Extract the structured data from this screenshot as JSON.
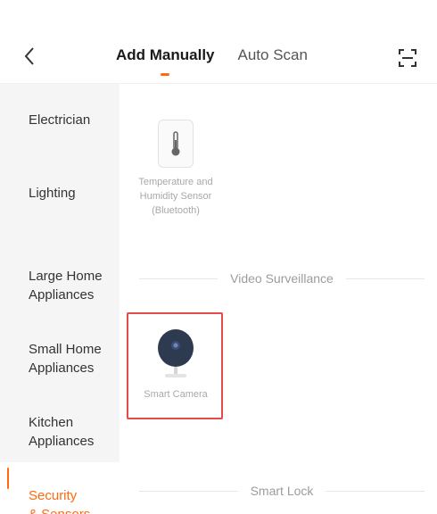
{
  "header": {
    "back_icon": "chevron-left-icon",
    "tabs": [
      {
        "label": "Add Manually",
        "active": true
      },
      {
        "label": "Auto Scan",
        "active": false
      }
    ],
    "scan_icon": "scan-frame-icon"
  },
  "sidebar": {
    "items": [
      {
        "label": "Electrician"
      },
      {
        "label": "Lighting"
      },
      {
        "label": "Large Home\nAppliances"
      },
      {
        "label": "Small Home\nAppliances"
      },
      {
        "label": "Kitchen\nAppliances"
      },
      {
        "label": "Security\n& Sensors",
        "active": true
      }
    ]
  },
  "content": {
    "devices": [
      {
        "label": "Temperature and Humidity Sensor (Bluetooth)",
        "icon": "thermometer-icon"
      },
      {
        "label": "Smart Camera",
        "icon": "camera-icon"
      }
    ],
    "sections": [
      {
        "title": "Video Surveillance"
      },
      {
        "title": "Smart Lock"
      }
    ]
  },
  "colors": {
    "accent": "#ff6a10",
    "highlight_border": "#e44c4c",
    "sidebar_bg": "#f5f5f5"
  }
}
